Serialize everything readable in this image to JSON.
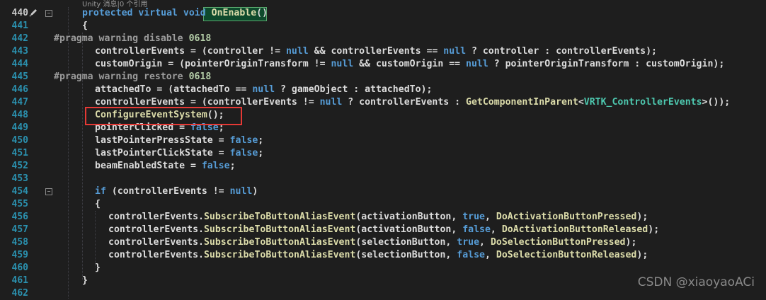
{
  "codelens": "Unity 消息|0 个引用",
  "watermark": "CSDN @xiaoyaoACi",
  "colors": {
    "background": "#1e1e1e",
    "line_number": "#2b91af",
    "keyword": "#569cd6",
    "method": "#dcdcaa",
    "type": "#4ec9b0",
    "number": "#b5cea8",
    "highlight_box": "#e53935"
  },
  "icons": {
    "edit": "pencil-icon",
    "fold": "collapse-minus-icon"
  },
  "lines": [
    {
      "n": "440",
      "fold": true,
      "tokens": [
        [
          "kw",
          "protected virtual void "
        ],
        [
          "method",
          "OnEnable"
        ],
        [
          "plain",
          "()"
        ]
      ]
    },
    {
      "n": "441",
      "tokens": [
        [
          "plain",
          "{"
        ]
      ]
    },
    {
      "n": "442",
      "tokens": [
        [
          "pp",
          "#pragma warning disable "
        ],
        [
          "num",
          "0618"
        ]
      ]
    },
    {
      "n": "443",
      "tokens": [
        [
          "plain",
          "controllerEvents = (controller != "
        ],
        [
          "kw",
          "null"
        ],
        [
          "plain",
          " && controllerEvents == "
        ],
        [
          "kw",
          "null"
        ],
        [
          "plain",
          " ? controller : controllerEvents);"
        ]
      ]
    },
    {
      "n": "444",
      "tokens": [
        [
          "plain",
          "customOrigin = (pointerOriginTransform != "
        ],
        [
          "kw",
          "null"
        ],
        [
          "plain",
          " && customOrigin == "
        ],
        [
          "kw",
          "null"
        ],
        [
          "plain",
          " ? pointerOriginTransform : customOrigin);"
        ]
      ]
    },
    {
      "n": "445",
      "tokens": [
        [
          "pp",
          "#pragma warning restore "
        ],
        [
          "num",
          "0618"
        ]
      ]
    },
    {
      "n": "446",
      "tokens": [
        [
          "plain",
          "attachedTo = (attachedTo == "
        ],
        [
          "kw",
          "null"
        ],
        [
          "plain",
          " ? gameObject : attachedTo);"
        ]
      ]
    },
    {
      "n": "447",
      "tokens": [
        [
          "plain",
          "controllerEvents = (controllerEvents != "
        ],
        [
          "kw",
          "null"
        ],
        [
          "plain",
          " ? controllerEvents : "
        ],
        [
          "method",
          "GetComponentInParent"
        ],
        [
          "plain",
          "<"
        ],
        [
          "typ",
          "VRTK_ControllerEvents"
        ],
        [
          "plain",
          ">());"
        ]
      ]
    },
    {
      "n": "448",
      "tokens": [
        [
          "method",
          "ConfigureEventSystem"
        ],
        [
          "plain",
          "();"
        ]
      ]
    },
    {
      "n": "449",
      "tokens": [
        [
          "plain",
          "pointerClicked = "
        ],
        [
          "kw",
          "false"
        ],
        [
          "plain",
          ";"
        ]
      ]
    },
    {
      "n": "450",
      "tokens": [
        [
          "plain",
          "lastPointerPressState = "
        ],
        [
          "kw",
          "false"
        ],
        [
          "plain",
          ";"
        ]
      ]
    },
    {
      "n": "451",
      "tokens": [
        [
          "plain",
          "lastPointerClickState = "
        ],
        [
          "kw",
          "false"
        ],
        [
          "plain",
          ";"
        ]
      ]
    },
    {
      "n": "452",
      "tokens": [
        [
          "plain",
          "beamEnabledState = "
        ],
        [
          "kw",
          "false"
        ],
        [
          "plain",
          ";"
        ]
      ]
    },
    {
      "n": "453",
      "tokens": []
    },
    {
      "n": "454",
      "fold": true,
      "tokens": [
        [
          "kw",
          "if"
        ],
        [
          "plain",
          " (controllerEvents != "
        ],
        [
          "kw",
          "null"
        ],
        [
          "plain",
          ")"
        ]
      ]
    },
    {
      "n": "455",
      "tokens": [
        [
          "plain",
          "{"
        ]
      ]
    },
    {
      "n": "456",
      "tokens": [
        [
          "plain",
          "controllerEvents."
        ],
        [
          "method",
          "SubscribeToButtonAliasEvent"
        ],
        [
          "plain",
          "(activationButton, "
        ],
        [
          "kw",
          "true"
        ],
        [
          "plain",
          ", "
        ],
        [
          "method",
          "DoActivationButtonPressed"
        ],
        [
          "plain",
          ");"
        ]
      ]
    },
    {
      "n": "457",
      "tokens": [
        [
          "plain",
          "controllerEvents."
        ],
        [
          "method",
          "SubscribeToButtonAliasEvent"
        ],
        [
          "plain",
          "(activationButton, "
        ],
        [
          "kw",
          "false"
        ],
        [
          "plain",
          ", "
        ],
        [
          "method",
          "DoActivationButtonReleased"
        ],
        [
          "plain",
          ");"
        ]
      ]
    },
    {
      "n": "458",
      "tokens": [
        [
          "plain",
          "controllerEvents."
        ],
        [
          "method",
          "SubscribeToButtonAliasEvent"
        ],
        [
          "plain",
          "(selectionButton, "
        ],
        [
          "kw",
          "true"
        ],
        [
          "plain",
          ", "
        ],
        [
          "method",
          "DoSelectionButtonPressed"
        ],
        [
          "plain",
          ");"
        ]
      ]
    },
    {
      "n": "459",
      "tokens": [
        [
          "plain",
          "controllerEvents."
        ],
        [
          "method",
          "SubscribeToButtonAliasEvent"
        ],
        [
          "plain",
          "(selectionButton, "
        ],
        [
          "kw",
          "false"
        ],
        [
          "plain",
          ", "
        ],
        [
          "method",
          "DoSelectionButtonReleased"
        ],
        [
          "plain",
          ");"
        ]
      ]
    },
    {
      "n": "460",
      "tokens": [
        [
          "plain",
          "}"
        ]
      ]
    },
    {
      "n": "461",
      "tokens": [
        [
          "plain",
          "}"
        ]
      ]
    },
    {
      "n": "462",
      "tokens": []
    }
  ]
}
